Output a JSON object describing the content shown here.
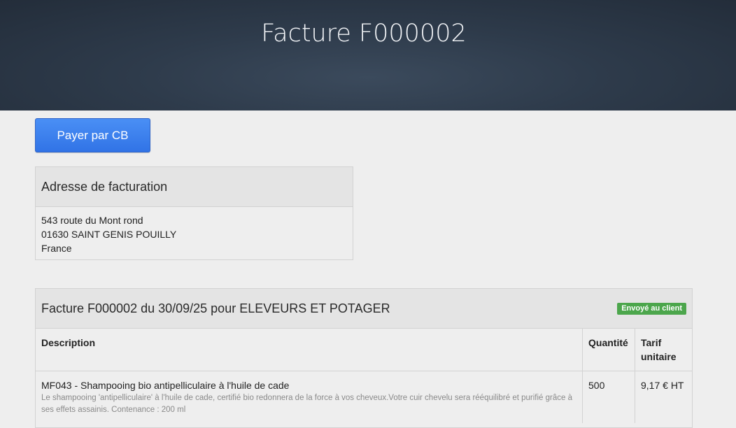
{
  "header": {
    "title": "Facture F000002"
  },
  "actions": {
    "pay_label": "Payer par CB"
  },
  "billing": {
    "title": "Adresse de facturation",
    "lines": [
      "543 route du Mont rond",
      "01630 SAINT GENIS POUILLY",
      "France"
    ]
  },
  "invoice": {
    "title": "Facture F000002 du 30/09/25 pour ELEVEURS ET POTAGER",
    "status": "Envoyé au client",
    "status_color": "#4ca64c",
    "columns": {
      "description": "Description",
      "quantity": "Quantité",
      "unit_price": "Tarif unitaire"
    },
    "items": [
      {
        "name": "MF043 - Shampooing bio antipelliculaire à l'huile de cade",
        "description": "Le shampooing 'antipelliculaire' à l'huile de cade, certifié bio redonnera de la force à vos cheveux.Votre cuir chevelu sera rééquilibré et purifié grâce à ses effets assainis. Contenance : 200 ml",
        "quantity": "500",
        "unit_price": "9,17 € HT"
      }
    ]
  },
  "colors": {
    "header_bg": "#2e3b4b",
    "button_bg": "#3b82f0",
    "page_bg": "#eeeeee"
  }
}
